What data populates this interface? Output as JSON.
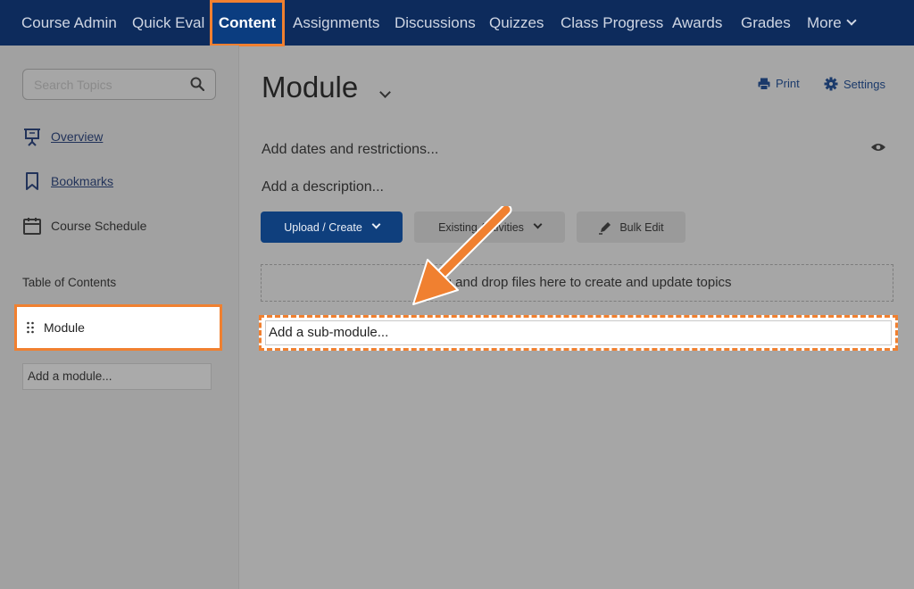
{
  "nav": {
    "items": [
      {
        "label": "Course Admin"
      },
      {
        "label": "Quick Eval"
      },
      {
        "label": "Content",
        "active": true
      },
      {
        "label": "Assignments"
      },
      {
        "label": "Discussions"
      },
      {
        "label": "Quizzes"
      },
      {
        "label": "Class Progress"
      },
      {
        "label": "Awards"
      },
      {
        "label": "Grades"
      },
      {
        "label": "More"
      }
    ]
  },
  "sidebar": {
    "search_placeholder": "Search Topics",
    "links": [
      {
        "label": "Overview",
        "icon": "presentation-icon"
      },
      {
        "label": "Bookmarks",
        "icon": "bookmark-icon"
      },
      {
        "label": "Course Schedule",
        "icon": "calendar-icon"
      }
    ],
    "toc_label": "Table of Contents",
    "module_item": "Module",
    "add_module": "Add a module..."
  },
  "main": {
    "title": "Module",
    "print_label": "Print",
    "settings_label": "Settings",
    "add_dates": "Add dates and restrictions...",
    "add_description": "Add a description...",
    "buttons": {
      "upload_create": "Upload / Create",
      "existing_activities": "Existing Activities",
      "bulk_edit": "Bulk Edit"
    },
    "dropzone": "Drag and drop files here to create and update topics",
    "add_submodule": "Add a sub-module..."
  },
  "colors": {
    "nav_bg": "#0d2b5c",
    "highlight": "#f08030",
    "primary_button": "#0f3f7d"
  }
}
